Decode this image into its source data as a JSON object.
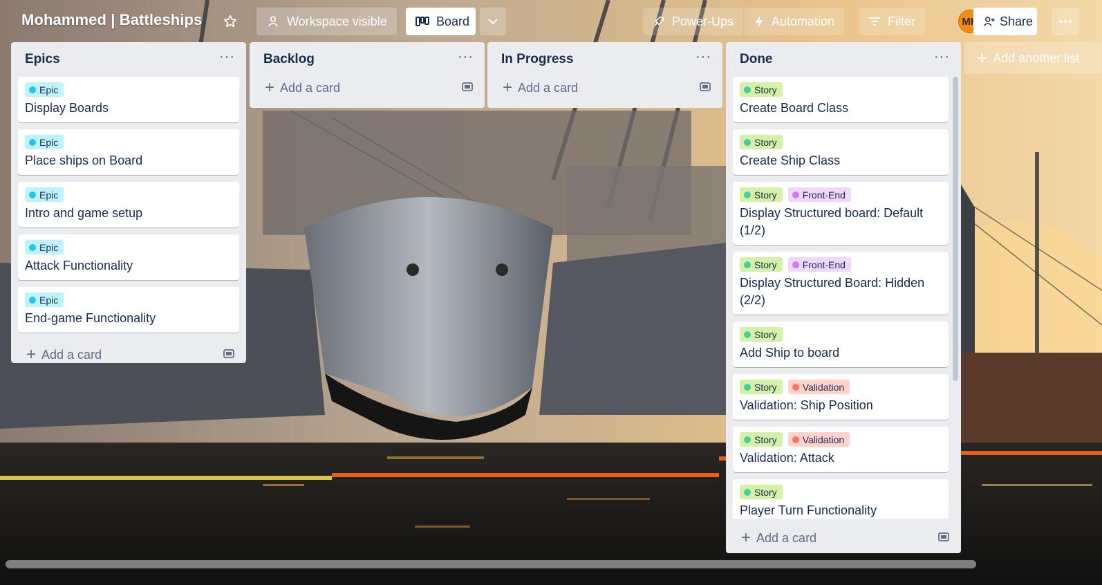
{
  "board": {
    "title": "Mohammed | Battleships",
    "workspace_visible_label": "Workspace visible",
    "board_view_label": "Board"
  },
  "header": {
    "powerups_label": "Power-Ups",
    "automation_label": "Automation",
    "filter_label": "Filter",
    "avatar_initials": "MH",
    "share_label": "Share"
  },
  "lists": [
    {
      "title": "Epics",
      "cards": [
        {
          "labels": [
            {
              "text": "Epic",
              "color": "epic"
            }
          ],
          "title": "Display Boards"
        },
        {
          "labels": [
            {
              "text": "Epic",
              "color": "epic"
            }
          ],
          "title": "Place ships on Board"
        },
        {
          "labels": [
            {
              "text": "Epic",
              "color": "epic"
            }
          ],
          "title": "Intro and game setup"
        },
        {
          "labels": [
            {
              "text": "Epic",
              "color": "epic"
            }
          ],
          "title": "Attack Functionality"
        },
        {
          "labels": [
            {
              "text": "Epic",
              "color": "epic"
            }
          ],
          "title": "End-game Functionality"
        }
      ],
      "add_card_label": "Add a card"
    },
    {
      "title": "Backlog",
      "cards": [],
      "add_card_label": "Add a card"
    },
    {
      "title": "In Progress",
      "cards": [],
      "add_card_label": "Add a card"
    },
    {
      "title": "Done",
      "cards": [
        {
          "labels": [
            {
              "text": "Story",
              "color": "story"
            }
          ],
          "title": "Create Board Class"
        },
        {
          "labels": [
            {
              "text": "Story",
              "color": "story"
            }
          ],
          "title": "Create Ship Class"
        },
        {
          "labels": [
            {
              "text": "Story",
              "color": "story"
            },
            {
              "text": "Front-End",
              "color": "frontend"
            }
          ],
          "title": "Display Structured board: Default (1/2)"
        },
        {
          "labels": [
            {
              "text": "Story",
              "color": "story"
            },
            {
              "text": "Front-End",
              "color": "frontend"
            }
          ],
          "title": "Display Structured Board: Hidden (2/2)"
        },
        {
          "labels": [
            {
              "text": "Story",
              "color": "story"
            }
          ],
          "title": "Add Ship to board"
        },
        {
          "labels": [
            {
              "text": "Story",
              "color": "story"
            },
            {
              "text": "Validation",
              "color": "validation"
            }
          ],
          "title": "Validation: Ship Position"
        },
        {
          "labels": [
            {
              "text": "Story",
              "color": "story"
            },
            {
              "text": "Validation",
              "color": "validation"
            }
          ],
          "title": "Validation: Attack"
        },
        {
          "labels": [
            {
              "text": "Story",
              "color": "story"
            }
          ],
          "title": "Player Turn Functionality"
        }
      ],
      "add_card_label": "Add a card"
    }
  ],
  "add_list_label": "Add another list",
  "label_colors": {
    "epic": {
      "bg": "#bff3fb",
      "dot": "#29c5e6"
    },
    "story": {
      "bg": "#d3f1a7",
      "dot": "#4bce97"
    },
    "frontend": {
      "bg": "#f1d7fa",
      "dot": "#c97cf4"
    },
    "validation": {
      "bg": "#ffd2cc",
      "dot": "#f87462"
    }
  },
  "icons": {
    "star": "star-icon",
    "workspace": "people-icon",
    "board": "board-icon",
    "chevron": "chevron-down-icon",
    "powerups": "rocket-icon",
    "automation": "lightning-icon",
    "filter": "filter-icon",
    "share": "add-person-icon",
    "more": "more-icon",
    "template": "template-icon"
  }
}
